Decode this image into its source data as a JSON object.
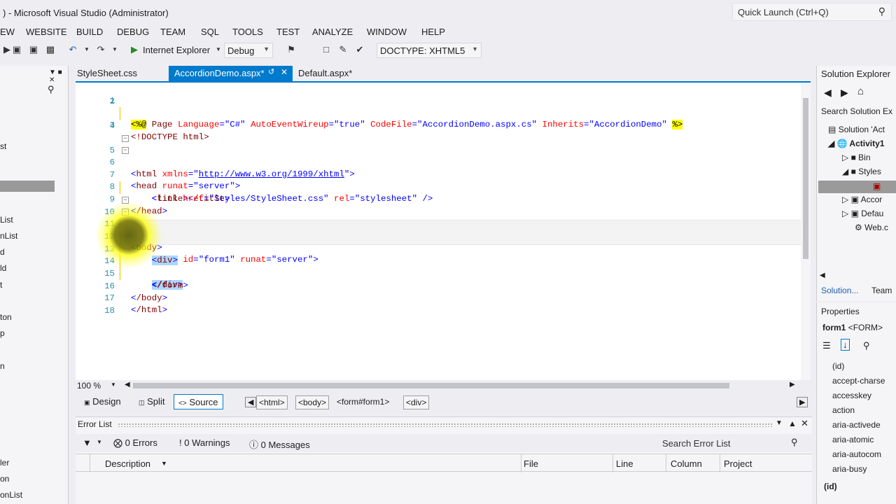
{
  "window": {
    "title": ") - Microsoft Visual Studio (Administrator)",
    "quick_launch_placeholder": "Quick Launch (Ctrl+Q)"
  },
  "menu": [
    "EW",
    "WEBSITE",
    "BUILD",
    "DEBUG",
    "TEAM",
    "SQL",
    "TOOLS",
    "TEST",
    "ANALYZE",
    "WINDOW",
    "HELP"
  ],
  "toolbar": {
    "run_target": "Internet Explorer",
    "configuration": "Debug",
    "doctype": "DOCTYPE: XHTML5"
  },
  "left_panel": {
    "items": [
      "st",
      "List",
      "nList",
      "d",
      "ld",
      "t",
      "ton",
      "p",
      "n",
      "ler",
      "on",
      "onList"
    ]
  },
  "tabs": [
    {
      "label": "StyleSheet.css",
      "active": false
    },
    {
      "label": "AccordionDemo.aspx*",
      "active": true
    },
    {
      "label": "Default.aspx*",
      "active": false
    }
  ],
  "editor": {
    "line_numbers": [
      "1",
      "2",
      "3",
      "4",
      "5",
      "6",
      "7",
      "8",
      "9",
      "10",
      "11",
      "12",
      "13",
      "14",
      "15",
      "16",
      "17",
      "18"
    ],
    "line1": {
      "open": "<%@",
      "page": " Page ",
      "a1": "Language",
      "v1": "\"C#\"",
      "a2": "AutoEventWireup",
      "v2": "\"true\"",
      "a3": "CodeFile",
      "v3": "\"AccordionDemo.aspx.cs\"",
      "a4": "Inherits",
      "v4": "\"AccordionDemo\"",
      "close": "%>"
    },
    "line3": "<!DOCTYPE html>",
    "line5": {
      "tag": "html",
      "attr": "xmlns",
      "url": "http://www.w3.org/1999/xhtml"
    },
    "line6": {
      "tag": "head",
      "attr": "runat",
      "val": "\"server\""
    },
    "line7": {
      "tag": "title",
      "close": "/title"
    },
    "line8": {
      "tag": "link",
      "a1": "href",
      "v1": "\"Styles/StyleSheet.css\"",
      "a2": "rel",
      "v2": "\"stylesheet\""
    },
    "line9": "/head",
    "line10": "body",
    "line11": {
      "tag": "form",
      "a1": "id",
      "v1": "\"form1\"",
      "a2": "runat",
      "v2": "\"server\""
    },
    "line12": "div",
    "line14": "/div",
    "line15": "/form",
    "line16": "/body",
    "line17": "/html"
  },
  "zoom": "100 %",
  "views": {
    "design": "Design",
    "split": "Split",
    "source": "Source"
  },
  "breadcrumb": [
    "<html>",
    "<body>",
    "<form#form1>",
    "<div>"
  ],
  "error_list": {
    "title": "Error List",
    "errors": "0 Errors",
    "warnings": "0 Warnings",
    "messages": "0 Messages",
    "search_placeholder": "Search Error List",
    "columns": [
      "Description",
      "File",
      "Line",
      "Column",
      "Project"
    ]
  },
  "solution_explorer": {
    "title": "Solution Explorer",
    "search_placeholder": "Search Solution Ex",
    "items": [
      "Solution 'Act",
      "Activity1",
      "Bin",
      "Styles",
      "Accor",
      "Defau",
      "Web.c"
    ],
    "tabs": [
      "Solution...",
      "Team"
    ]
  },
  "properties": {
    "title": "Properties",
    "object": "form1",
    "object_type": "<FORM>",
    "items": [
      "(id)",
      "accept-charse",
      "accesskey",
      "action",
      "aria-activede",
      "aria-atomic",
      "aria-autocom",
      "aria-busy"
    ],
    "footer": "(id)"
  }
}
